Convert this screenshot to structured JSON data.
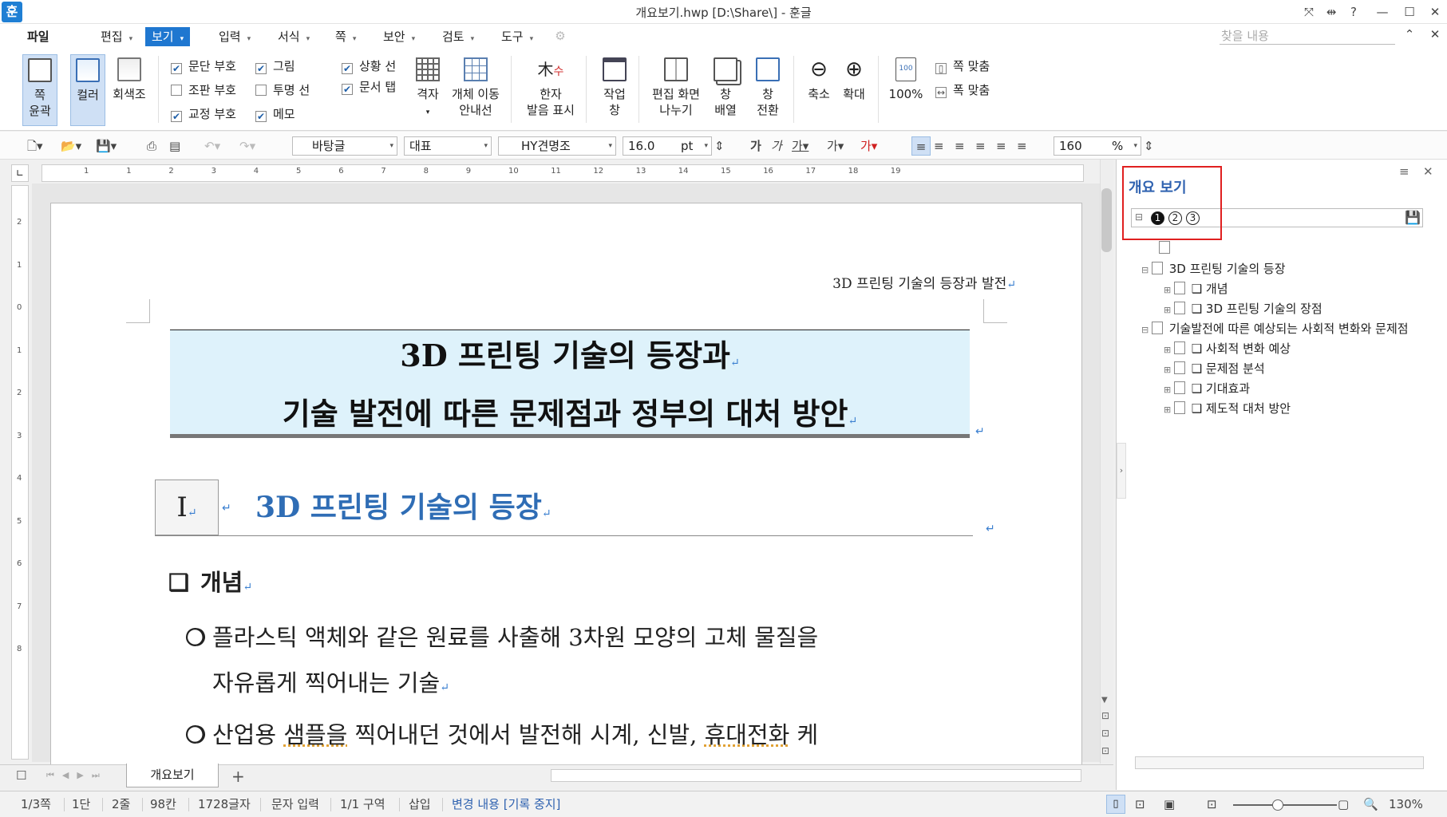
{
  "window": {
    "title": "개요보기.hwp [D:\\Share\\] - 훈글",
    "logo": "훈"
  },
  "menus": [
    {
      "label": "파일"
    },
    {
      "label": "편집"
    },
    {
      "label": "보기"
    },
    {
      "label": "입력"
    },
    {
      "label": "서식"
    },
    {
      "label": "쪽"
    },
    {
      "label": "보안"
    },
    {
      "label": "검토"
    },
    {
      "label": "도구"
    }
  ],
  "find_placeholder": "찾을 내용",
  "ribbon": {
    "page_outline": "쪽\n윤곽",
    "page_outline_1": "쪽",
    "page_outline_2": "윤곽",
    "color": "컬러",
    "gray": "회색조",
    "checks": [
      {
        "label": "문단 부호",
        "checked": true
      },
      {
        "label": "조판 부호",
        "checked": false
      },
      {
        "label": "교정 부호",
        "checked": true
      },
      {
        "label": "그림",
        "checked": true
      },
      {
        "label": "투명 선",
        "checked": false
      },
      {
        "label": "메모",
        "checked": true
      },
      {
        "label": "상황 선",
        "checked": true
      },
      {
        "label": "문서 탭",
        "checked": true
      }
    ],
    "grid": "격자",
    "guide_1": "개체 이동",
    "guide_2": "안내선",
    "hanja_1": "한자",
    "hanja_2": "발음 표시",
    "work_1": "작업",
    "work_2": "창",
    "split_1": "편집 화면",
    "split_2": "나누기",
    "arrange_1": "창",
    "arrange_2": "배열",
    "switch_1": "창",
    "switch_2": "전환",
    "zoom_out": "축소",
    "zoom_in": "확대",
    "zoom_100": "100%",
    "fit_page": "쪽 맞춤",
    "fit_width": "폭 맞춤"
  },
  "format": {
    "style": "바탕글",
    "lang": "대표",
    "font": "HY견명조",
    "size": "16.0",
    "unit": "pt",
    "zoom": "160",
    "zoom_unit": "%"
  },
  "document": {
    "header": "3D 프린팅 기술의 등장과 발전",
    "title_line1": "3D 프린팅 기술의 등장과",
    "title_line2": "기술 발전에 따른 문제점과 정부의 대처 방안",
    "section_num": "I",
    "section_title": "3D 프린팅 기술의 등장",
    "sub_title": "개념",
    "para1_line1": "플라스틱 액체와 같은 원료를 사출해 3차원 모양의 고체 물질을",
    "para1_line2": "자유롭게 찍어내는 기술",
    "para2_a": "산업용 ",
    "para2_b": "샘플을",
    "para2_c": " 찍어내던 것에서 발전해 시계, 신발, ",
    "para2_d": "휴대전화",
    "para2_e": " 케"
  },
  "ruler": {
    "h": [
      "1",
      "1",
      "2",
      "3",
      "4",
      "5",
      "6",
      "7",
      "8",
      "9",
      "10",
      "11",
      "12",
      "13",
      "14",
      "15",
      "16",
      "17",
      "18",
      "19"
    ],
    "v": [
      "2",
      "1",
      "0",
      "1",
      "2",
      "3",
      "4",
      "5",
      "6",
      "7",
      "8"
    ]
  },
  "doc_tab": "개요보기",
  "outline_panel": {
    "title": "개요 보기",
    "levels": [
      "1",
      "2",
      "3"
    ],
    "items": [
      {
        "label": "3D 프린팅 기술의 등장",
        "level": 1
      },
      {
        "label": "❑ 개념",
        "level": 2
      },
      {
        "label": "❑ 3D 프린팅 기술의 장점",
        "level": 2
      },
      {
        "label": "기술발전에 따른 예상되는 사회적 변화와 문제점",
        "level": 1
      },
      {
        "label": "❑ 사회적 변화 예상",
        "level": 2
      },
      {
        "label": "❑ 문제점 분석",
        "level": 2
      },
      {
        "label": "❑ 기대효과",
        "level": 2
      },
      {
        "label": "❑ 제도적 대처 방안",
        "level": 2
      }
    ]
  },
  "status": {
    "page": "1/3쪽",
    "col": "1단",
    "line": "2줄",
    "pos": "98칸",
    "chars": "1728글자",
    "mode": "문자 입력",
    "section": "1/1 구역",
    "insert": "삽입",
    "track": "변경 내용 [기록 중지]",
    "zoom": "130%"
  },
  "colors": {
    "accent": "#1f77d0",
    "title_bg": "#def2fb",
    "section": "#2f6db5",
    "highlight": "#e02020"
  }
}
